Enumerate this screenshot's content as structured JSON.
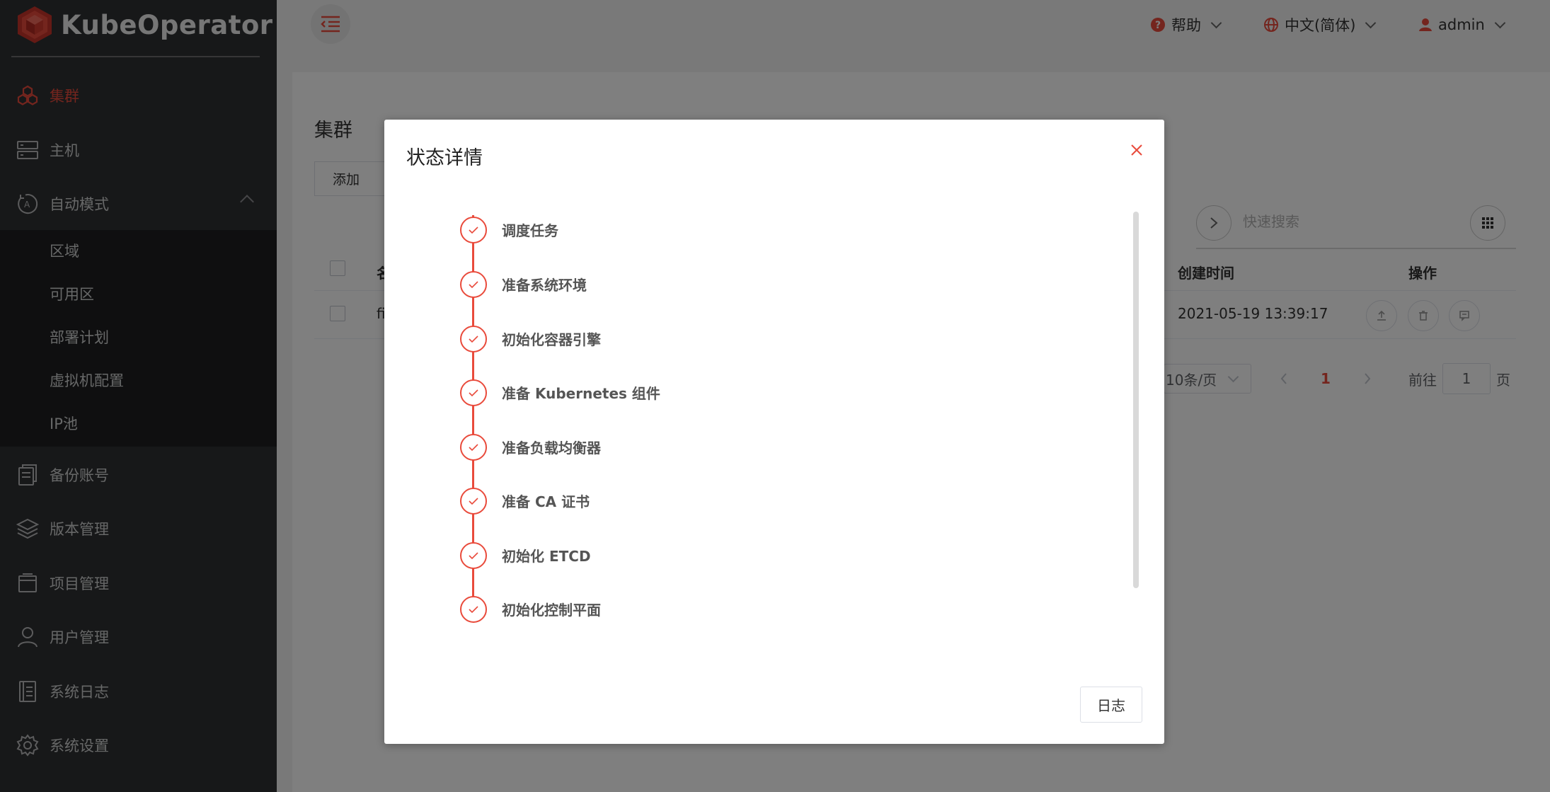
{
  "brand": {
    "name": "KubeOperator"
  },
  "sidebar": {
    "items": [
      {
        "label": "集群",
        "icon": "cluster-icon"
      },
      {
        "label": "主机",
        "icon": "host-icon"
      },
      {
        "label": "自动模式",
        "icon": "auto-mode-icon"
      },
      {
        "label": "备份账号",
        "icon": "backup-icon"
      },
      {
        "label": "版本管理",
        "icon": "layers-icon"
      },
      {
        "label": "项目管理",
        "icon": "project-icon"
      },
      {
        "label": "用户管理",
        "icon": "user-icon"
      },
      {
        "label": "系统日志",
        "icon": "log-icon"
      },
      {
        "label": "系统设置",
        "icon": "gear-icon"
      }
    ],
    "subitems": [
      "区域",
      "可用区",
      "部署计划",
      "虚拟机配置",
      "IP池"
    ]
  },
  "header": {
    "help": "帮助",
    "language": "中文(简体)",
    "user": "admin"
  },
  "main": {
    "title": "集群",
    "add_button": "添加",
    "search_placeholder": "快速搜索",
    "columns": {
      "name": "名",
      "created": "创建时间",
      "actions": "操作"
    },
    "row": {
      "name": "fi",
      "created": "2021-05-19 13:39:17"
    },
    "pagination": {
      "page_size": "10条/页",
      "current_page": "1",
      "goto_label": "前往",
      "goto_value": "1",
      "page_suffix": "页"
    }
  },
  "dialog": {
    "title": "状态详情",
    "steps": [
      "调度任务",
      "准备系统环境",
      "初始化容器引擎",
      "准备 Kubernetes 组件",
      "准备负载均衡器",
      "准备 CA 证书",
      "初始化 ETCD",
      "初始化控制平面"
    ],
    "log_button": "日志"
  },
  "colors": {
    "accent": "#e94b3c",
    "sidebar_bg": "#2f3032",
    "submenu_bg": "#1e1f21"
  }
}
